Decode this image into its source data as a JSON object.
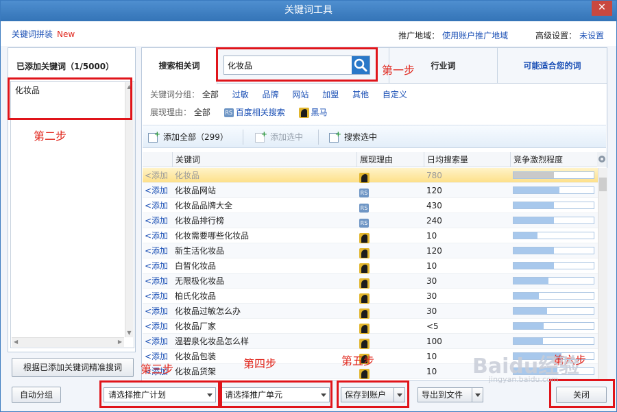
{
  "window": {
    "title": "关键词工具",
    "close_label": "✕"
  },
  "topline": {
    "left_link": "关键词拼装",
    "new_badge": "New",
    "region_label": "推广地域：",
    "region_value": "使用账户推广地域",
    "adv_label": "高级设置：",
    "adv_value": "未设置"
  },
  "left": {
    "title": "已添加关键词（1/5000）",
    "keywords": [
      "化妆品"
    ],
    "precise_button": "根据已添加关键词精准搜词",
    "auto_group_button": "自动分组"
  },
  "tabs": {
    "related": "搜索相关词",
    "industry": "行业词",
    "maybe": "可能适合您的词"
  },
  "search": {
    "value": "化妆品"
  },
  "filters": {
    "group_label": "关键词分组：",
    "group_items": [
      "全部",
      "过敏",
      "品牌",
      "网站",
      "加盟",
      "其他",
      "自定义"
    ],
    "reason_label": "展现理由：",
    "reason_all": "全部",
    "reason_baidu": "百度相关搜索",
    "reason_horse": "黑马",
    "rs_badge": "RS"
  },
  "toolbar": {
    "add_all": "添加全部（299）",
    "add_selected": "添加选中",
    "search_selected": "搜索选中"
  },
  "grid": {
    "headers": {
      "keyword": "关键词",
      "reason": "展现理由",
      "volume": "日均搜索量",
      "competition": "竞争激烈程度"
    },
    "add_label": "<添加",
    "rows": [
      {
        "keyword": "化妆品",
        "reason": "horse",
        "volume": "780",
        "competition": 0.5
      },
      {
        "keyword": "化妆品网站",
        "reason": "rs",
        "volume": "120",
        "competition": 0.57
      },
      {
        "keyword": "化妆品品牌大全",
        "reason": "rs",
        "volume": "430",
        "competition": 0.5
      },
      {
        "keyword": "化妆品排行榜",
        "reason": "rs",
        "volume": "240",
        "competition": 0.5
      },
      {
        "keyword": "化妆需要哪些化妆品",
        "reason": "horse",
        "volume": "10",
        "competition": 0.3
      },
      {
        "keyword": "新生活化妆品",
        "reason": "horse",
        "volume": "120",
        "competition": 0.5
      },
      {
        "keyword": "白皙化妆品",
        "reason": "horse",
        "volume": "10",
        "competition": 0.5
      },
      {
        "keyword": "无限极化妆品",
        "reason": "horse",
        "volume": "30",
        "competition": 0.44
      },
      {
        "keyword": "柏氏化妆品",
        "reason": "horse",
        "volume": "30",
        "competition": 0.32
      },
      {
        "keyword": "化妆品过敏怎么办",
        "reason": "horse",
        "volume": "30",
        "competition": 0.42
      },
      {
        "keyword": "化妆品厂家",
        "reason": "horse",
        "volume": "<5",
        "competition": 0.38
      },
      {
        "keyword": "温碧泉化妆品怎么样",
        "reason": "horse",
        "volume": "100",
        "competition": 0.37
      },
      {
        "keyword": "化妆品包装",
        "reason": "horse",
        "volume": "10",
        "competition": 0.6
      },
      {
        "keyword": "化妆品货架",
        "reason": "horse",
        "volume": "10",
        "competition": 0.55
      }
    ]
  },
  "bottom": {
    "plan_select": "请选择推广计划",
    "unit_select": "请选择推广单元",
    "save_button": "保存到账户",
    "export_button": "导出到文件",
    "close_button": "关闭"
  },
  "annotations": {
    "step1": "第一步",
    "step2": "第二步",
    "step3": "第三步",
    "step4": "第四步",
    "step5": "第五步",
    "step6": "第六步",
    "highlight_color": "#e0141a"
  },
  "watermark": {
    "brand": "Baidu经验",
    "url": "jingyan.baidu.com"
  }
}
